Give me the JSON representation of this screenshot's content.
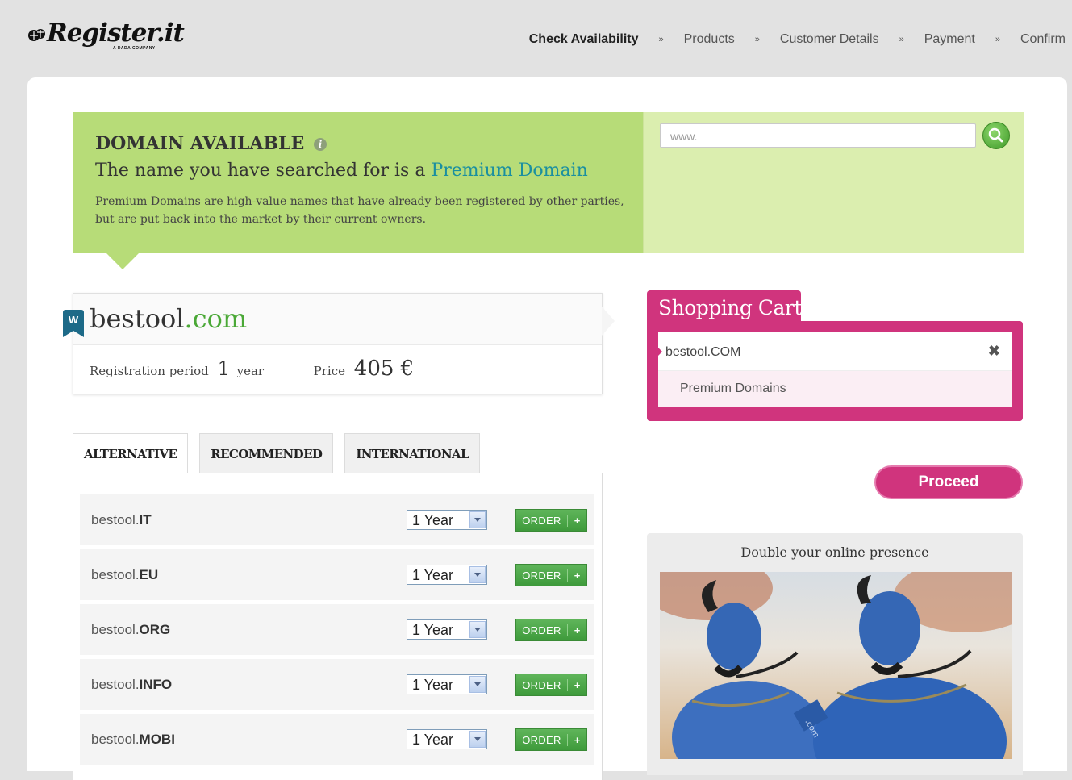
{
  "brand": {
    "name": "Register.it",
    "tagline": "A DADA COMPANY"
  },
  "steps": [
    {
      "label": "Check Availability",
      "active": true
    },
    {
      "label": "Products",
      "active": false
    },
    {
      "label": "Customer Details",
      "active": false
    },
    {
      "label": "Payment",
      "active": false
    },
    {
      "label": "Confirm",
      "active": false
    }
  ],
  "step_separator": "»",
  "banner": {
    "title": "DOMAIN AVAILABLE",
    "subtitle_prefix": "The name you have searched for is a ",
    "subtitle_link": "Premium Domain",
    "description": "Premium Domains are high-value names that have already been registered by other parties, but are put back into the market by their current owners."
  },
  "search": {
    "placeholder": "www."
  },
  "domain": {
    "badge": "W",
    "name": "bestool",
    "tld": ".com",
    "period_label": "Registration period",
    "period_value": "1",
    "period_unit": "year",
    "price_label": "Price",
    "price_value": "405 €"
  },
  "tabs": [
    {
      "label": "ALTERNATIVE",
      "active": true
    },
    {
      "label": "RECOMMENDED",
      "active": false
    },
    {
      "label": "INTERNATIONAL",
      "active": false
    }
  ],
  "alternatives": [
    {
      "name": "bestool.",
      "tld": "IT",
      "period": "1 Year",
      "order": "ORDER",
      "plus": "+"
    },
    {
      "name": "bestool.",
      "tld": "EU",
      "period": "1 Year",
      "order": "ORDER",
      "plus": "+"
    },
    {
      "name": "bestool.",
      "tld": "ORG",
      "period": "1 Year",
      "order": "ORDER",
      "plus": "+"
    },
    {
      "name": "bestool.",
      "tld": "INFO",
      "period": "1 Year",
      "order": "ORDER",
      "plus": "+"
    },
    {
      "name": "bestool.",
      "tld": "MOBI",
      "period": "1 Year",
      "order": "ORDER",
      "plus": "+"
    }
  ],
  "cart": {
    "title": "Shopping Cart",
    "item": "bestool.COM",
    "remove_icon": "✖",
    "category": "Premium Domains",
    "proceed": "Proceed"
  },
  "promo": {
    "title": "Double your online presence",
    "image_text": ".com"
  },
  "colors": {
    "green_banner": "#b7dc78",
    "cart_pink": "#d0347d",
    "link_teal": "#1a8fa0",
    "order_green": "#4ea84a"
  }
}
